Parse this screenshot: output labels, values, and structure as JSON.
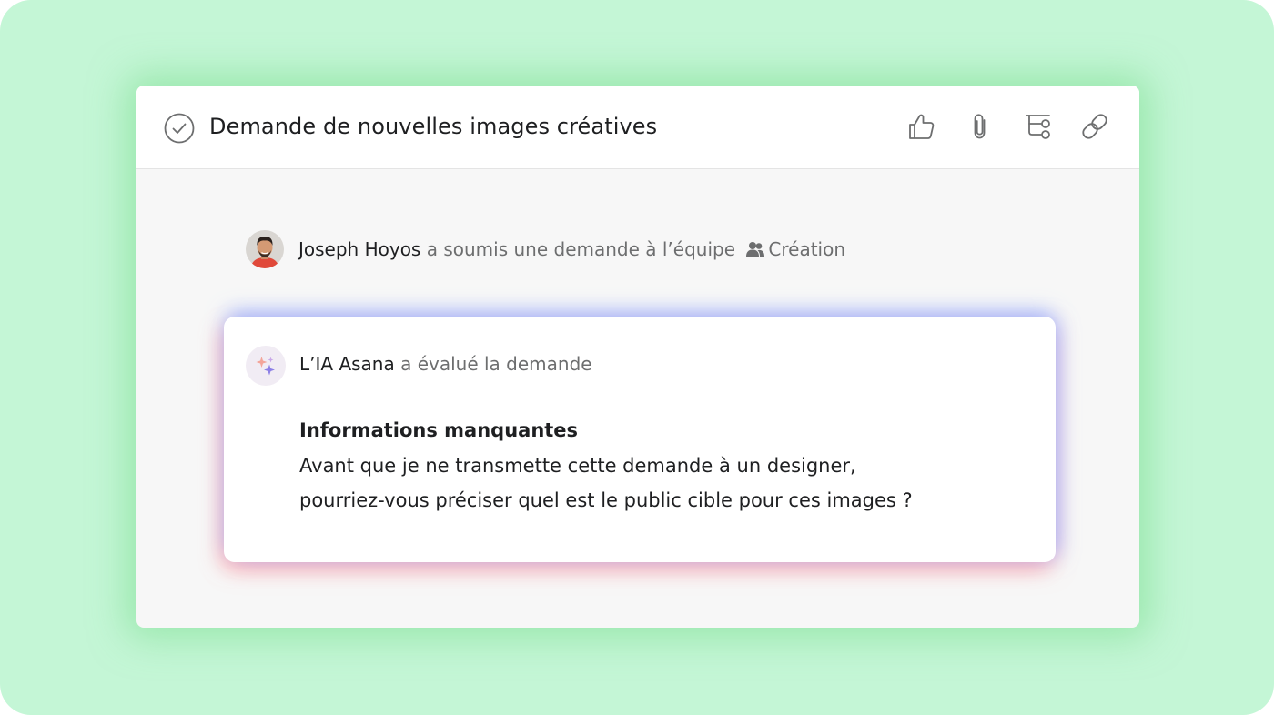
{
  "task": {
    "title": "Demande de nouvelles images créatives",
    "actions": [
      {
        "name": "like",
        "icon": "thumbs-up-icon"
      },
      {
        "name": "attach",
        "icon": "paperclip-icon"
      },
      {
        "name": "subtask",
        "icon": "subtask-icon"
      },
      {
        "name": "copy-link",
        "icon": "link-icon"
      }
    ]
  },
  "submission": {
    "user_name": "Joseph Hoyos",
    "action_text": "a soumis une demande à l’équipe",
    "team_name": "Création"
  },
  "ai_evaluation": {
    "author": "L’IA Asana",
    "action_text": "a évalué la demande",
    "heading": "Informations manquantes",
    "lines": [
      "Avant que je ne transmette cette demande à un designer,",
      "pourriez-vous préciser quel est le public cible pour ces images ?"
    ]
  },
  "colors": {
    "background": "#c4f6d6",
    "panel": "#f7f7f7",
    "text_primary": "#1e1f21",
    "text_secondary": "#6d6e6f",
    "icon": "#6d6e6f"
  }
}
